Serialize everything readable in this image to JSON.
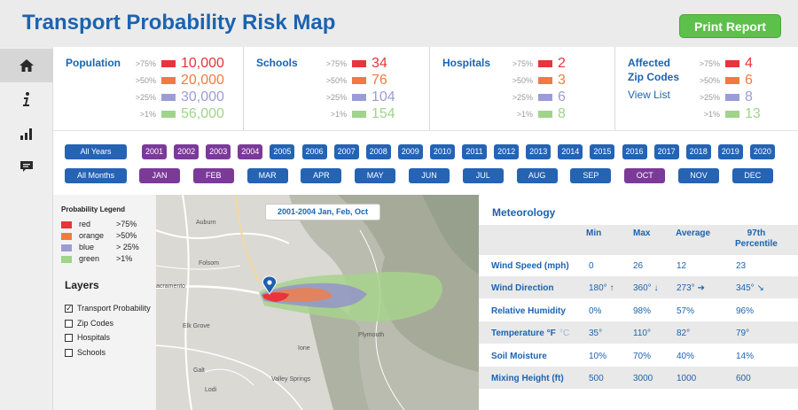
{
  "header": {
    "title": "Transport Probability Risk Map",
    "print_label": "Print Report"
  },
  "sidebar": {
    "items": [
      {
        "name": "home-icon",
        "active": true
      },
      {
        "name": "info-icon",
        "active": false
      },
      {
        "name": "bar-chart-icon",
        "active": false
      },
      {
        "name": "comment-icon",
        "active": false
      }
    ]
  },
  "colors": {
    "red": "#e8343a",
    "orange": "#f07a40",
    "blue": "#9c9cd4",
    "green": "#9fd48a",
    "accent": "#1b63b0",
    "selected": "#7b3a98",
    "unselected": "#2563b3"
  },
  "stats": {
    "population": {
      "title": "Population",
      "rows": [
        {
          "thr": ">75%",
          "value": "10,000",
          "color": "#e8343a"
        },
        {
          "thr": ">50%",
          "value": "20,000",
          "color": "#f07a40"
        },
        {
          "thr": ">25%",
          "value": "30,000",
          "color": "#9c9cd4"
        },
        {
          "thr": ">1%",
          "value": "56,000",
          "color": "#9fd48a"
        }
      ]
    },
    "schools": {
      "title": "Schools",
      "rows": [
        {
          "thr": ">75%",
          "value": "34",
          "color": "#e8343a"
        },
        {
          "thr": ">50%",
          "value": "76",
          "color": "#f07a40"
        },
        {
          "thr": ">25%",
          "value": "104",
          "color": "#9c9cd4"
        },
        {
          "thr": ">1%",
          "value": "154",
          "color": "#9fd48a"
        }
      ]
    },
    "hospitals": {
      "title": "Hospitals",
      "rows": [
        {
          "thr": ">75%",
          "value": "2",
          "color": "#e8343a"
        },
        {
          "thr": ">50%",
          "value": "3",
          "color": "#f07a40"
        },
        {
          "thr": ">25%",
          "value": "6",
          "color": "#9c9cd4"
        },
        {
          "thr": ">1%",
          "value": "8",
          "color": "#9fd48a"
        }
      ]
    },
    "zip": {
      "title_line1": "Affected",
      "title_line2": "Zip Codes",
      "view_list": "View List",
      "rows": [
        {
          "thr": ">75%",
          "value": "4",
          "color": "#e8343a"
        },
        {
          "thr": ">50%",
          "value": "6",
          "color": "#f07a40"
        },
        {
          "thr": ">25%",
          "value": "8",
          "color": "#9c9cd4"
        },
        {
          "thr": ">1%",
          "value": "13",
          "color": "#9fd48a"
        }
      ]
    }
  },
  "filters": {
    "all_years": "All Years",
    "all_months": "All Months",
    "years": [
      {
        "label": "2001",
        "selected": true
      },
      {
        "label": "2002",
        "selected": true
      },
      {
        "label": "2003",
        "selected": true
      },
      {
        "label": "2004",
        "selected": true
      },
      {
        "label": "2005",
        "selected": false
      },
      {
        "label": "2006",
        "selected": false
      },
      {
        "label": "2007",
        "selected": false
      },
      {
        "label": "2008",
        "selected": false
      },
      {
        "label": "2009",
        "selected": false
      },
      {
        "label": "2010",
        "selected": false
      },
      {
        "label": "2011",
        "selected": false
      },
      {
        "label": "2012",
        "selected": false
      },
      {
        "label": "2013",
        "selected": false
      },
      {
        "label": "2014",
        "selected": false
      },
      {
        "label": "2015",
        "selected": false
      },
      {
        "label": "2016",
        "selected": false
      },
      {
        "label": "2017",
        "selected": false
      },
      {
        "label": "2018",
        "selected": false
      },
      {
        "label": "2019",
        "selected": false
      },
      {
        "label": "2020",
        "selected": false
      }
    ],
    "months": [
      {
        "label": "JAN",
        "selected": true
      },
      {
        "label": "FEB",
        "selected": true
      },
      {
        "label": "MAR",
        "selected": false
      },
      {
        "label": "APR",
        "selected": false
      },
      {
        "label": "MAY",
        "selected": false
      },
      {
        "label": "JUN",
        "selected": false
      },
      {
        "label": "JUL",
        "selected": false
      },
      {
        "label": "AUG",
        "selected": false
      },
      {
        "label": "SEP",
        "selected": false
      },
      {
        "label": "OCT",
        "selected": true
      },
      {
        "label": "NOV",
        "selected": false
      },
      {
        "label": "DEC",
        "selected": false
      }
    ]
  },
  "legend": {
    "title": "Probability Legend",
    "items": [
      {
        "name": "red",
        "pct": ">75%",
        "color": "#e8343a"
      },
      {
        "name": "orange",
        "pct": ">50%",
        "color": "#f07a40"
      },
      {
        "name": "blue",
        "pct": "> 25%",
        "color": "#9c9cd4"
      },
      {
        "name": "green",
        "pct": ">1%",
        "color": "#9fd48a"
      }
    ]
  },
  "layers": {
    "title": "Layers",
    "items": [
      {
        "label": "Transport Probability",
        "checked": true
      },
      {
        "label": "Zip Codes",
        "checked": false
      },
      {
        "label": "Hospitals",
        "checked": false
      },
      {
        "label": "Schools",
        "checked": false
      }
    ]
  },
  "map": {
    "tag": "2001-2004   Jan, Feb, Oct",
    "place_labels": [
      "Folsom",
      "acramento",
      "Elk Grove",
      "Lodi",
      "Valley Springs",
      "Ione",
      "Galt",
      "Plymouth",
      "Auburn"
    ]
  },
  "meteorology": {
    "title": "Meteorology",
    "columns": [
      "Min",
      "Max",
      "Average",
      "97th",
      "Percentile"
    ],
    "rows": [
      {
        "label": "Wind Speed (mph)",
        "min": "0",
        "max": "26",
        "avg": "12",
        "p97": "23"
      },
      {
        "label": "Wind Direction",
        "min": "180° ↑",
        "max": "360° ↓",
        "avg": "273° ➔",
        "p97": "345° ↘"
      },
      {
        "label": "Relative Humidity",
        "min": "0%",
        "max": "98%",
        "avg": "57%",
        "p97": "96%"
      },
      {
        "label": "Temperature °F",
        "unit_alt": "°C",
        "min": "35°",
        "max": "110°",
        "avg": "82°",
        "p97": "79°"
      },
      {
        "label": "Soil Moisture",
        "min": "10%",
        "max": "70%",
        "avg": "40%",
        "p97": "14%"
      },
      {
        "label": "Mixing Height (ft)",
        "min": "500",
        "max": "3000",
        "avg": "1000",
        "p97": "600"
      }
    ]
  }
}
